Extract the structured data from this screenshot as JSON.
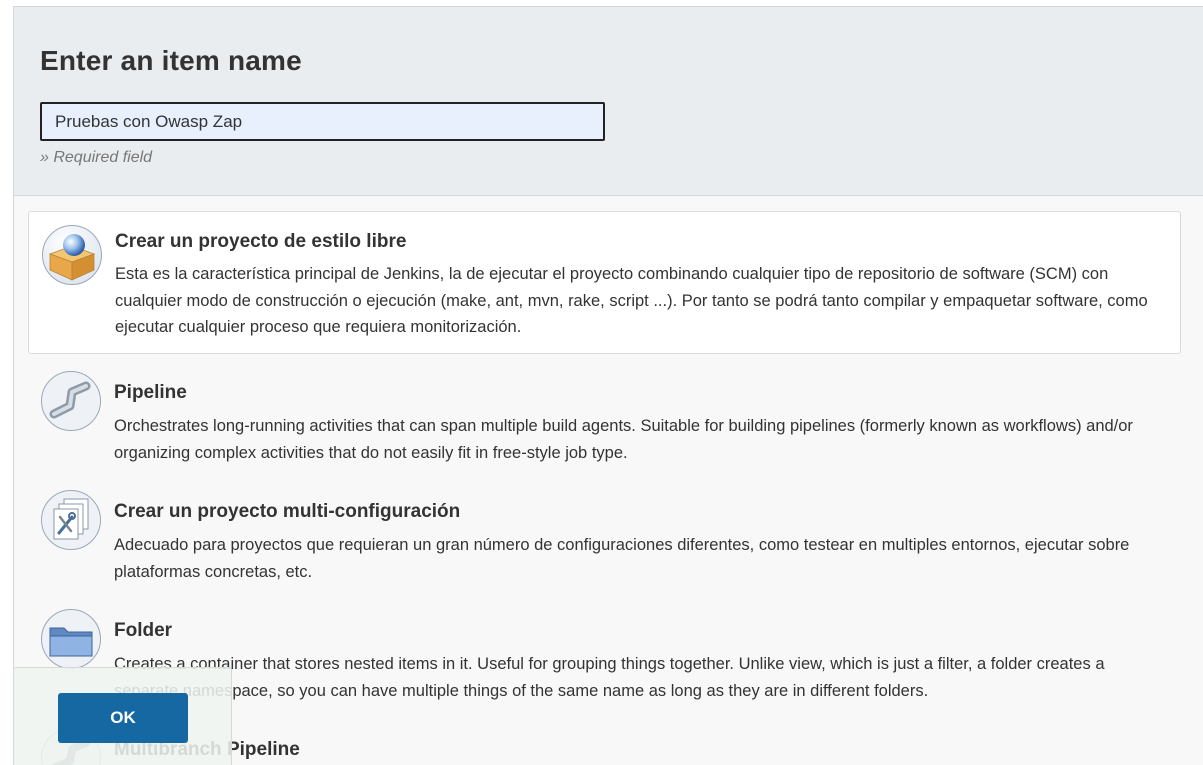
{
  "header": {
    "title": "Enter an item name",
    "input_value": "Pruebas con Owasp Zap",
    "required_note": "» Required field"
  },
  "items": [
    {
      "title": "Crear un proyecto de estilo libre",
      "description": "Esta es la característica principal de Jenkins, la de ejecutar el proyecto combinando cualquier tipo de repositorio de software (SCM) con cualquier modo de construcción o ejecución (make, ant, mvn, rake, script ...). Por tanto se podrá tanto compilar y empaquetar software, como ejecutar cualquier proceso que requiera monitorización.",
      "icon": "freestyle-box-icon",
      "selected": true
    },
    {
      "title": "Pipeline",
      "description": "Orchestrates long-running activities that can span multiple build agents. Suitable for building pipelines (formerly known as workflows) and/or organizing complex activities that do not easily fit in free-style job type.",
      "icon": "pipeline-pipe-icon",
      "selected": false
    },
    {
      "title": "Crear un proyecto multi-configuración",
      "description": "Adecuado para proyectos que requieran un gran número de configuraciones diferentes, como testear en multiples entornos, ejecutar sobre plataformas concretas, etc.",
      "icon": "multi-config-icon",
      "selected": false
    },
    {
      "title": "Folder",
      "description": "Creates a container that stores nested items in it. Useful for grouping things together. Unlike view, which is just a filter, a folder creates a separate namespace, so you can have multiple things of the same name as long as they are in different folders.",
      "icon": "folder-icon",
      "selected": false
    },
    {
      "title": "Multibranch Pipeline",
      "description": "",
      "icon": "multibranch-pipeline-icon",
      "selected": false
    }
  ],
  "footer": {
    "ok_label": "OK"
  },
  "colors": {
    "header_bg": "#e9edf0",
    "ok_button": "#1668a3",
    "selected_item_bg": "#ffffff"
  }
}
